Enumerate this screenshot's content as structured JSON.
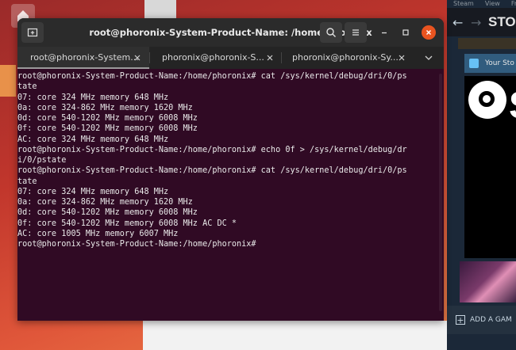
{
  "window": {
    "title": "root@phoronix-System-Product-Name: /home/phoronix"
  },
  "tabs": [
    {
      "label": "root@phoronix-System..."
    },
    {
      "label": "phoronix@phoronix-S..."
    },
    {
      "label": "phoronix@phoronix-Sy..."
    }
  ],
  "terminal": {
    "lines": [
      "root@phoronix-System-Product-Name:/home/phoronix# cat /sys/kernel/debug/dri/0/ps",
      "tate",
      "07: core 324 MHz memory 648 MHz",
      "0a: core 324-862 MHz memory 1620 MHz",
      "0d: core 540-1202 MHz memory 6008 MHz",
      "0f: core 540-1202 MHz memory 6008 MHz",
      "AC: core 324 MHz memory 648 MHz",
      "root@phoronix-System-Product-Name:/home/phoronix# echo 0f > /sys/kernel/debug/dr",
      "i/0/pstate",
      "root@phoronix-System-Product-Name:/home/phoronix# cat /sys/kernel/debug/dri/0/ps",
      "tate",
      "07: core 324 MHz memory 648 MHz",
      "0a: core 324-862 MHz memory 1620 MHz",
      "0d: core 540-1202 MHz memory 6008 MHz",
      "0f: core 540-1202 MHz memory 6008 MHz AC DC *",
      "AC: core 1005 MHz memory 6007 MHz",
      "root@phoronix-System-Product-Name:/home/phoronix# "
    ]
  },
  "steam": {
    "menu": [
      "Steam",
      "View",
      "Fr"
    ],
    "nav_title": "STO",
    "your_store": "Your Sto",
    "logo_letter": "S",
    "add_game": "ADD A GAM"
  },
  "colors": {
    "terminal_bg": "#300a24",
    "close_button": "#e95420",
    "steam_bg": "#1b2838"
  }
}
